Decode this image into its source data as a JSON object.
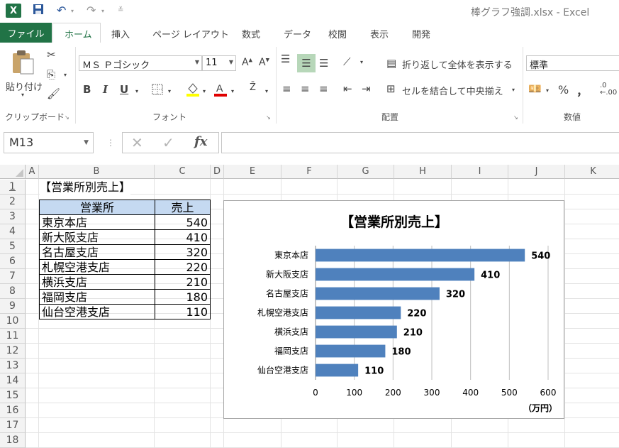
{
  "window": {
    "title": "棒グラフ強調.xlsx - Excel",
    "app_icon": "X"
  },
  "quick_access": {
    "save_icon": "save-icon",
    "undo_icon": "undo-icon",
    "redo_icon": "redo-icon"
  },
  "ribbon_tabs": [
    "ファイル",
    "ホーム",
    "挿入",
    "ページ レイアウト",
    "数式",
    "データ",
    "校閲",
    "表示",
    "開発"
  ],
  "ribbon": {
    "clipboard": {
      "paste_label": "貼り付け",
      "group_label": "クリップボード"
    },
    "font": {
      "font_name": "ＭＳ Ｐゴシック",
      "font_size": "11",
      "group_label": "フォント",
      "bold": "B",
      "italic": "I",
      "underline": "U"
    },
    "alignment": {
      "wrap_text": "折り返して全体を表示する",
      "merge_center": "セルを結合して中央揃え",
      "group_label": "配置"
    },
    "number": {
      "format": "標準",
      "percent": "%",
      "comma": "，",
      "group_label": "数値"
    }
  },
  "formula_bar": {
    "name_box": "M13",
    "formula": ""
  },
  "columns": [
    "A",
    "B",
    "C",
    "D",
    "E",
    "F",
    "G",
    "H",
    "I",
    "J",
    "K"
  ],
  "rows": [
    "1",
    "2",
    "3",
    "4",
    "5",
    "6",
    "7",
    "8",
    "9",
    "10",
    "11",
    "12",
    "13",
    "14",
    "15",
    "16",
    "17",
    "18"
  ],
  "sheet": {
    "b1": "【営業所別売上】",
    "table": {
      "headers": [
        "営業所",
        "売上"
      ],
      "rows": [
        [
          "東京本店",
          "540"
        ],
        [
          "新大阪支店",
          "410"
        ],
        [
          "名古屋支店",
          "320"
        ],
        [
          "札幌空港支店",
          "220"
        ],
        [
          "横浜支店",
          "210"
        ],
        [
          "福岡支店",
          "180"
        ],
        [
          "仙台空港支店",
          "110"
        ]
      ]
    }
  },
  "chart_data": {
    "type": "bar",
    "orientation": "horizontal",
    "title": "【営業所別売上】",
    "categories": [
      "東京本店",
      "新大阪支店",
      "名古屋支店",
      "札幌空港支店",
      "横浜支店",
      "福岡支店",
      "仙台空港支店"
    ],
    "values": [
      540,
      410,
      320,
      220,
      210,
      180,
      110
    ],
    "xlim": [
      0,
      600
    ],
    "xticks": [
      0,
      100,
      200,
      300,
      400,
      500,
      600
    ],
    "xlabel": "（万円）",
    "ylabel": "",
    "bar_color": "#4f81bd",
    "grid": "vertical",
    "data_labels": true
  }
}
